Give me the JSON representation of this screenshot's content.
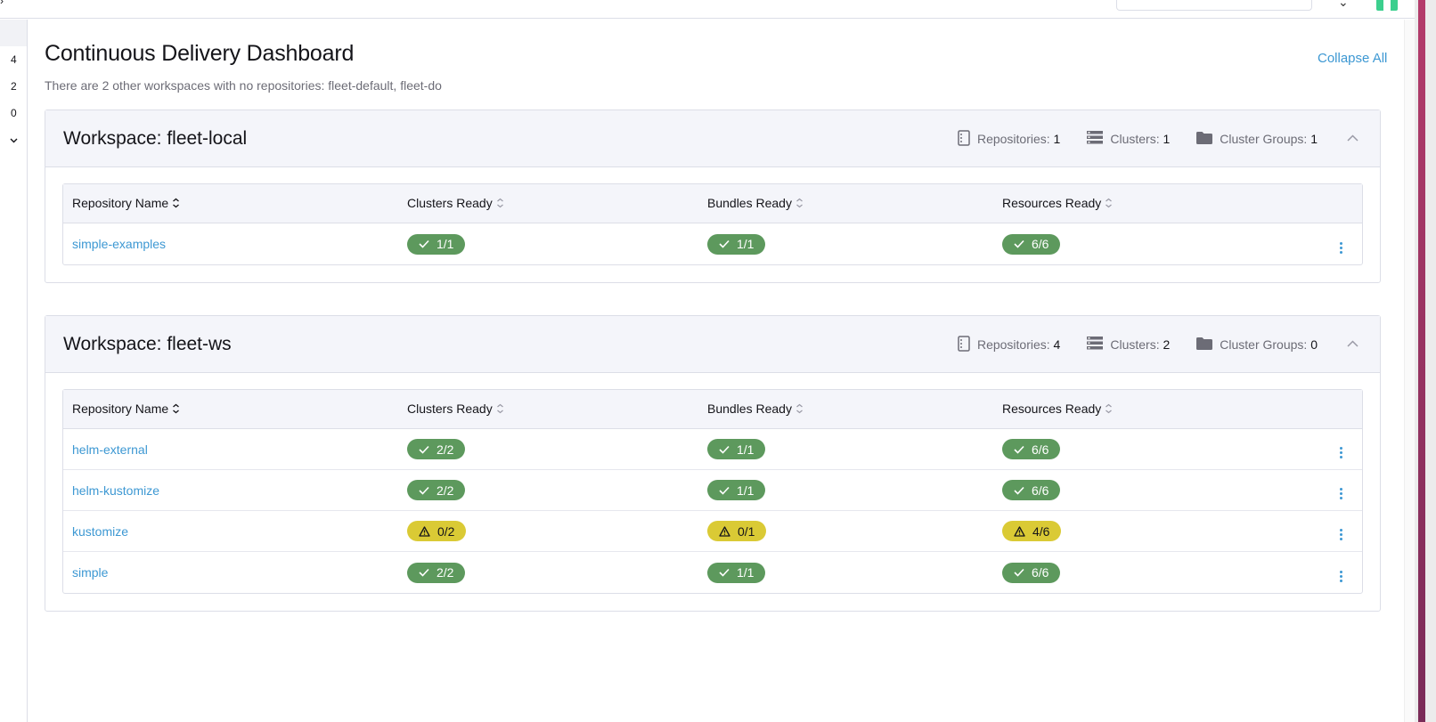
{
  "rail": {
    "counts": [
      "4",
      "2",
      "0"
    ]
  },
  "page": {
    "title": "Continuous Delivery Dashboard",
    "collapse_all": "Collapse All",
    "subtitle": "There are 2 other workspaces with no repositories: fleet-default, fleet-do"
  },
  "columns": [
    "Repository Name",
    "Clusters Ready",
    "Bundles Ready",
    "Resources Ready"
  ],
  "stat_labels": {
    "repositories": "Repositories:",
    "clusters": "Clusters:",
    "cluster_groups": "Cluster Groups:"
  },
  "workspaces": [
    {
      "title": "Workspace: fleet-local",
      "repositories": "1",
      "clusters": "1",
      "cluster_groups": "1",
      "rows": [
        {
          "name": "simple-examples",
          "clusters": "1/1",
          "clusters_state": "ok",
          "bundles": "1/1",
          "bundles_state": "ok",
          "resources": "6/6",
          "resources_state": "ok"
        }
      ]
    },
    {
      "title": "Workspace: fleet-ws",
      "repositories": "4",
      "clusters": "2",
      "cluster_groups": "0",
      "rows": [
        {
          "name": "helm-external",
          "clusters": "2/2",
          "clusters_state": "ok",
          "bundles": "1/1",
          "bundles_state": "ok",
          "resources": "6/6",
          "resources_state": "ok"
        },
        {
          "name": "helm-kustomize",
          "clusters": "2/2",
          "clusters_state": "ok",
          "bundles": "1/1",
          "bundles_state": "ok",
          "resources": "6/6",
          "resources_state": "ok"
        },
        {
          "name": "kustomize",
          "clusters": "0/2",
          "clusters_state": "warn",
          "bundles": "0/1",
          "bundles_state": "warn",
          "resources": "4/6",
          "resources_state": "warn"
        },
        {
          "name": "simple",
          "clusters": "2/2",
          "clusters_state": "ok",
          "bundles": "1/1",
          "bundles_state": "ok",
          "resources": "6/6",
          "resources_state": "ok"
        }
      ]
    }
  ],
  "colors": {
    "accent": "#3d98d3",
    "ok": "#5d995d",
    "warn": "#daca35",
    "header_bg": "#f4f5fa",
    "border": "#dcdee7"
  },
  "icons": {
    "repositories": "repository-icon",
    "clusters": "cluster-list-icon",
    "cluster_groups": "folder-icon",
    "ok": "check-icon",
    "warn": "warning-icon",
    "sort": "sort-icon",
    "toggle": "chevron-up-icon",
    "actions": "kebab-menu-icon"
  }
}
